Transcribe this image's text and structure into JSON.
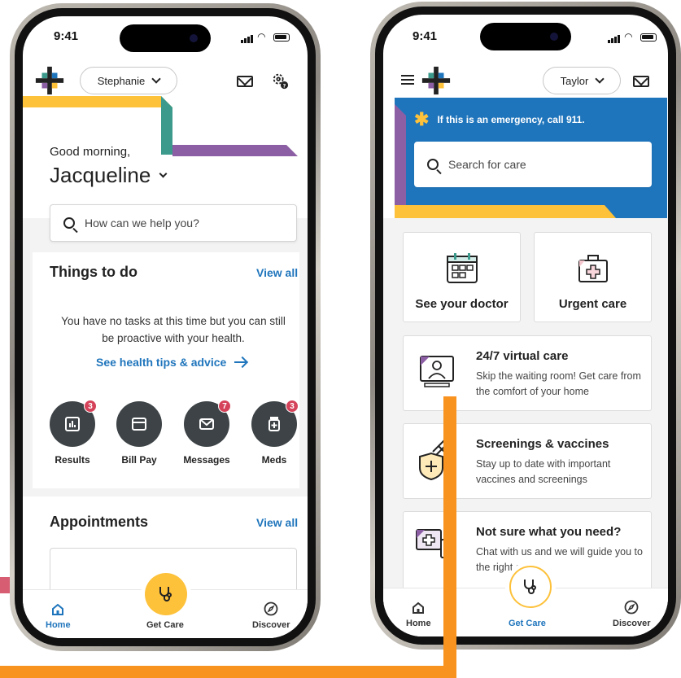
{
  "colors": {
    "brand_blue": "#1f75bc",
    "brand_yellow": "#fdc13a",
    "brand_teal": "#3b9a8c",
    "brand_purple": "#8c5ea4",
    "brand_pink": "#d65d72",
    "brand_orange": "#f7931e",
    "badge_red": "#d5435a",
    "dark_circle": "#3d4346"
  },
  "left": {
    "status": {
      "time": "9:41"
    },
    "profile_name": "Stephanie",
    "greeting": "Good morning,",
    "user_name": "Jacqueline",
    "search_placeholder": "How can we help you?",
    "things_to_do": {
      "title": "Things to do",
      "view_all": "View all",
      "empty_text": "You have no tasks at this time but you can still be proactive with your health.",
      "tips_link": "See health tips & advice"
    },
    "quick_actions": [
      {
        "label": "Results",
        "badge": "3",
        "icon": "chart-icon"
      },
      {
        "label": "Bill Pay",
        "badge": "",
        "icon": "credit-card-icon"
      },
      {
        "label": "Messages",
        "badge": "7",
        "icon": "mail-icon"
      },
      {
        "label": "Meds",
        "badge": "3",
        "icon": "pill-bottle-icon"
      }
    ],
    "appointments": {
      "title": "Appointments",
      "view_all": "View all"
    },
    "nav": {
      "home": "Home",
      "get_care": "Get Care",
      "discover": "Discover"
    }
  },
  "right": {
    "status": {
      "time": "9:41"
    },
    "profile_name": "Taylor",
    "emergency_text": "If this is an emergency, call 911.",
    "search_placeholder": "Search for care",
    "tiles": [
      {
        "label": "See your doctor",
        "icon": "calendar-icon"
      },
      {
        "label": "Urgent care",
        "icon": "first-aid-kit-icon"
      }
    ],
    "cards": [
      {
        "title": "24/7 virtual care",
        "desc": "Skip the waiting room! Get care from the comfort of your home",
        "icon": "video-doctor-icon"
      },
      {
        "title": "Screenings & vaccines",
        "desc": "Stay up to date with important vaccines and screenings",
        "icon": "syringe-shield-icon"
      },
      {
        "title": "Not sure what you need?",
        "desc": "Chat with us and we will guide you to the right care",
        "icon": "chat-medical-icon"
      }
    ],
    "nav": {
      "home": "Home",
      "get_care": "Get Care",
      "discover": "Discover"
    }
  }
}
